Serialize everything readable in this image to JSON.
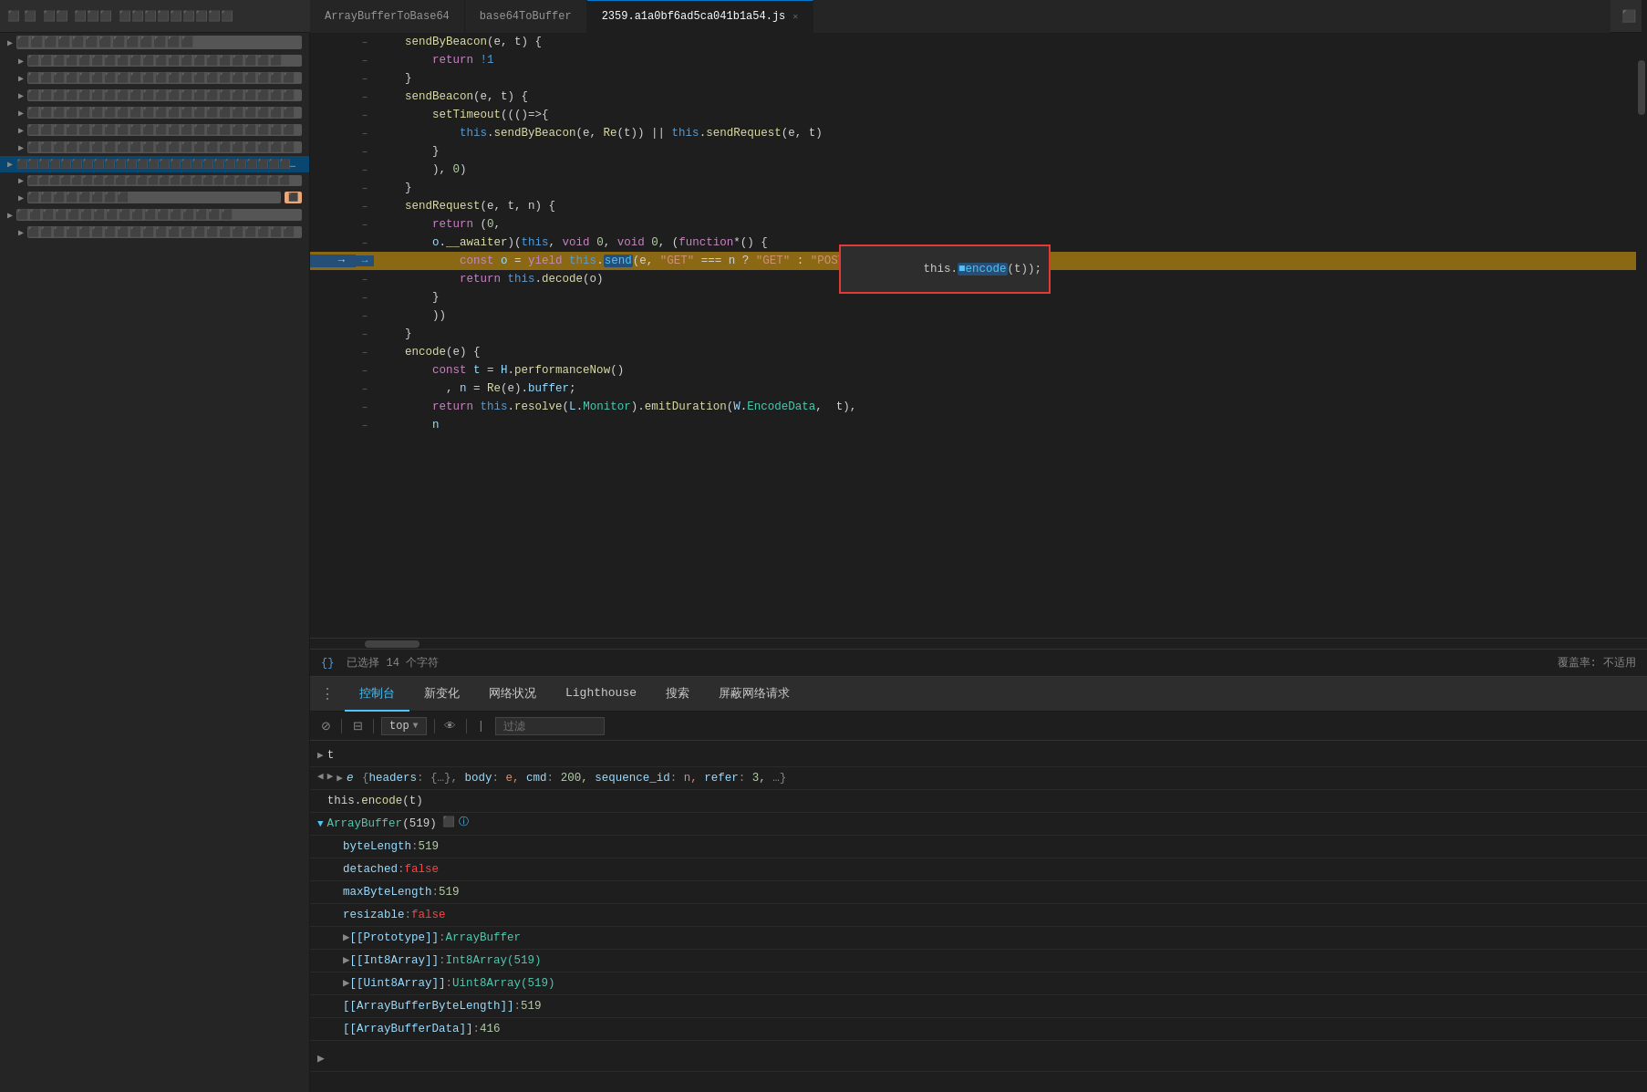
{
  "tabs": {
    "items": [
      {
        "label": "ArrayBufferToBase64",
        "active": false,
        "closable": false
      },
      {
        "label": "base64ToBuffer",
        "active": false,
        "closable": false
      },
      {
        "label": "2359.a1a0bf6ad5ca041b1a54.js",
        "active": true,
        "closable": true
      }
    ]
  },
  "code": {
    "lines": [
      {
        "num": "",
        "arrow": "–",
        "content": "    sendByBeacon(e, t) {"
      },
      {
        "num": "",
        "arrow": "–",
        "content": "        return !1"
      },
      {
        "num": "",
        "arrow": "–",
        "content": "    }"
      },
      {
        "num": "",
        "arrow": "–",
        "content": "    sendBeacon(e, t) {"
      },
      {
        "num": "",
        "arrow": "–",
        "content": "        setTimeout(()=>{"
      },
      {
        "num": "",
        "arrow": "–",
        "content": "            this.sendByBeacon(e, Re(t)) || this.sendRequest(e, t)"
      },
      {
        "num": "",
        "arrow": "–",
        "content": "        }"
      },
      {
        "num": "",
        "arrow": "–",
        "content": "        ), 0)"
      },
      {
        "num": "",
        "arrow": "–",
        "content": "    }"
      },
      {
        "num": "",
        "arrow": "–",
        "content": "    sendRequest(e, t, n) {"
      },
      {
        "num": "",
        "arrow": "–",
        "content": "        return (0,"
      },
      {
        "num": "",
        "arrow": "–",
        "content": "        o.__awaiter)(this, void 0, void 0, (function*() {"
      },
      {
        "num": "",
        "arrow": "→",
        "content": "            const o = yield this.send(e, \"GET\" === n ? \"GET\" : \"POST\", this.encode(t));",
        "highlighted": true
      },
      {
        "num": "",
        "arrow": "–",
        "content": "            return this.decode(o)"
      },
      {
        "num": "",
        "arrow": "–",
        "content": "        }"
      },
      {
        "num": "",
        "arrow": "–",
        "content": "        ))"
      },
      {
        "num": "",
        "arrow": "–",
        "content": "    }"
      },
      {
        "num": "",
        "arrow": "–",
        "content": "    encode(e) {"
      },
      {
        "num": "",
        "arrow": "–",
        "content": "        const t = H.performanceNow()"
      },
      {
        "num": "",
        "arrow": "–",
        "content": "          , n = Re(e).buffer;"
      },
      {
        "num": "",
        "arrow": "–",
        "content": "        return this.resolve(L.Monitor).emitDuration(W.EncodeData,  t),"
      },
      {
        "num": "",
        "arrow": "–",
        "content": "        n"
      }
    ]
  },
  "tooltip": {
    "content": " this.⬛encode(t));"
  },
  "status_bar": {
    "icon": "{}",
    "text": "已选择 14 个字符",
    "right_text": "覆盖率: 不适用"
  },
  "devtools": {
    "tabs": [
      {
        "label": "控制台",
        "active": true
      },
      {
        "label": "新变化",
        "active": false
      },
      {
        "label": "网络状况",
        "active": false
      },
      {
        "label": "Lighthouse",
        "active": false
      },
      {
        "label": "搜索",
        "active": false
      },
      {
        "label": "屏蔽网络请求",
        "active": false
      }
    ],
    "toolbar": {
      "level_label": "top",
      "filter_placeholder": "过滤"
    },
    "console_entries": [
      {
        "type": "plain",
        "text": "t",
        "expandable": true,
        "indent": 0
      },
      {
        "type": "object",
        "text": "e  {headers: {…}, body: e, cmd: 200, sequence_id: n, refer: 3,  …}",
        "expandable": true,
        "indent": 0,
        "arrow_left": true
      },
      {
        "type": "plain",
        "text": "this.encode(t)",
        "expandable": false,
        "indent": 0
      },
      {
        "type": "arraybuffer",
        "label": "ArrayBuffer(519)",
        "expandable": true,
        "expanded": true,
        "has_icons": true,
        "properties": [
          {
            "key": "byteLength",
            "value": "519",
            "type": "num"
          },
          {
            "key": "detached",
            "value": "false",
            "type": "false"
          },
          {
            "key": "maxByteLength",
            "value": "519",
            "type": "num"
          },
          {
            "key": "resizable",
            "value": "false",
            "type": "false"
          },
          {
            "key": "[[Prototype]]",
            "value": "ArrayBuffer",
            "type": "link"
          },
          {
            "key": "[[Int8Array]]",
            "value": "Int8Array(519)",
            "type": "link"
          },
          {
            "key": "[[Uint8Array]]",
            "value": "Uint8Array(519)",
            "type": "link"
          },
          {
            "key": "[[ArrayBufferByteLength]]",
            "value": "519",
            "type": "num",
            "highlight": true
          },
          {
            "key": "[[ArrayBufferData]]",
            "value": "416",
            "type": "num"
          }
        ]
      }
    ]
  },
  "sidebar": {
    "items": [
      {
        "label": "⬛⬛⬛⬛⬛⬛",
        "indent": 0,
        "selected": false
      },
      {
        "label": "⬛⬛⬛⬛⬛ ⬛⬛⬛⬛⬛⬛",
        "indent": 1,
        "selected": false
      },
      {
        "label": "⬛⬛⬛⬛⬛⬛ ⬛⬛⬛⬛⬛⬛⬛⬛",
        "indent": 1,
        "selected": false
      },
      {
        "label": "⬛⬛⬛⬛⬛ ⬛⬛⬛⬛⬛⬛ ⬛⬛⬛⬛⬛⬛",
        "indent": 1,
        "selected": false
      },
      {
        "label": "⬛⬛⬛ ⬛⬛⬛⬛ ⬛⬛⬛ ⬛⬛⬛⬛⬛⬛⬛⬛⬛",
        "indent": 1,
        "selected": false
      },
      {
        "label": "⬛⬛⬛⬛ ⬛⬛⬛⬛⬛ ⬛⬛ ⬛⬛⬛⬛⬛⬛⬛",
        "indent": 1,
        "selected": false
      },
      {
        "label": "⬛⬛⬛⬛ ⬛⬛⬛⬛⬛ ⬛⬛ ⬛⬛⬛⬛⬛⬛⬛⬛⬛⬛⬛",
        "indent": 1,
        "selected": false
      },
      {
        "label": "⬛⬛⬛⬛⬛ ⬛⬛⬛⬛⬛⬛⬛ ⬛⬛⬛⬛ ⬛⬛⬛⬛⬛⬛⬛⬛⬛⬛⬛⬛⬛⬛⬛⬛⬛⬛",
        "indent": 0,
        "selected": true
      },
      {
        "label": "⬛⬛⬛⬛⬛⬛⬛⬛⬛⬛⬛ ⬛⬛⬛⬛⬛⬛⬛⬛⬛⬛ ⬛⬛⬛⬛⬛⬛⬛⬛⬛⬛⬛⬛⬛",
        "indent": 1,
        "selected": false
      },
      {
        "label": "⬛⬛⬛⬛⬛",
        "indent": 1,
        "selected": false
      },
      {
        "label": "⬛⬛⬛⬛⬛ ⬛⬛⬛⬛⬛ ⬛⬛⬛⬛⬛⬛⬛⬛",
        "indent": 0,
        "selected": false
      },
      {
        "label": "⬛⬛⬛⬛⬛⬛⬛⬛⬛ ⬛⬛⬛⬛⬛⬛⬛⬛⬛⬛ ⬛⬛⬛⬛⬛",
        "indent": 1,
        "selected": false
      }
    ]
  }
}
